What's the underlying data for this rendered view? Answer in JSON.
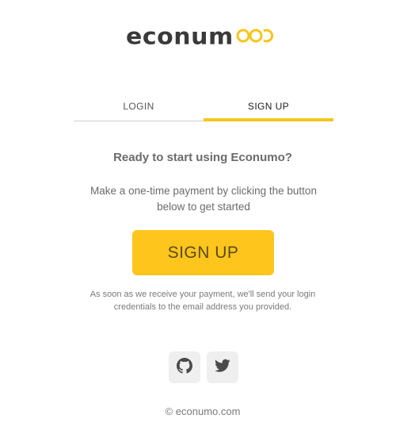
{
  "brand": {
    "logo_text": "econum",
    "accent_color": "#fec51c"
  },
  "tabs": [
    {
      "label": "LOGIN",
      "active": false
    },
    {
      "label": "SIGN UP",
      "active": true
    }
  ],
  "signup": {
    "headline": "Ready to start using Econumo?",
    "description": "Make a one-time payment by clicking the button below to get started",
    "button_label": "SIGN UP",
    "note": "As soon as we receive your payment, we'll send your login credentials to the email address you provided."
  },
  "socials": [
    {
      "icon": "github-icon"
    },
    {
      "icon": "twitter-icon"
    }
  ],
  "footer": {
    "text": "© econumo.com"
  }
}
